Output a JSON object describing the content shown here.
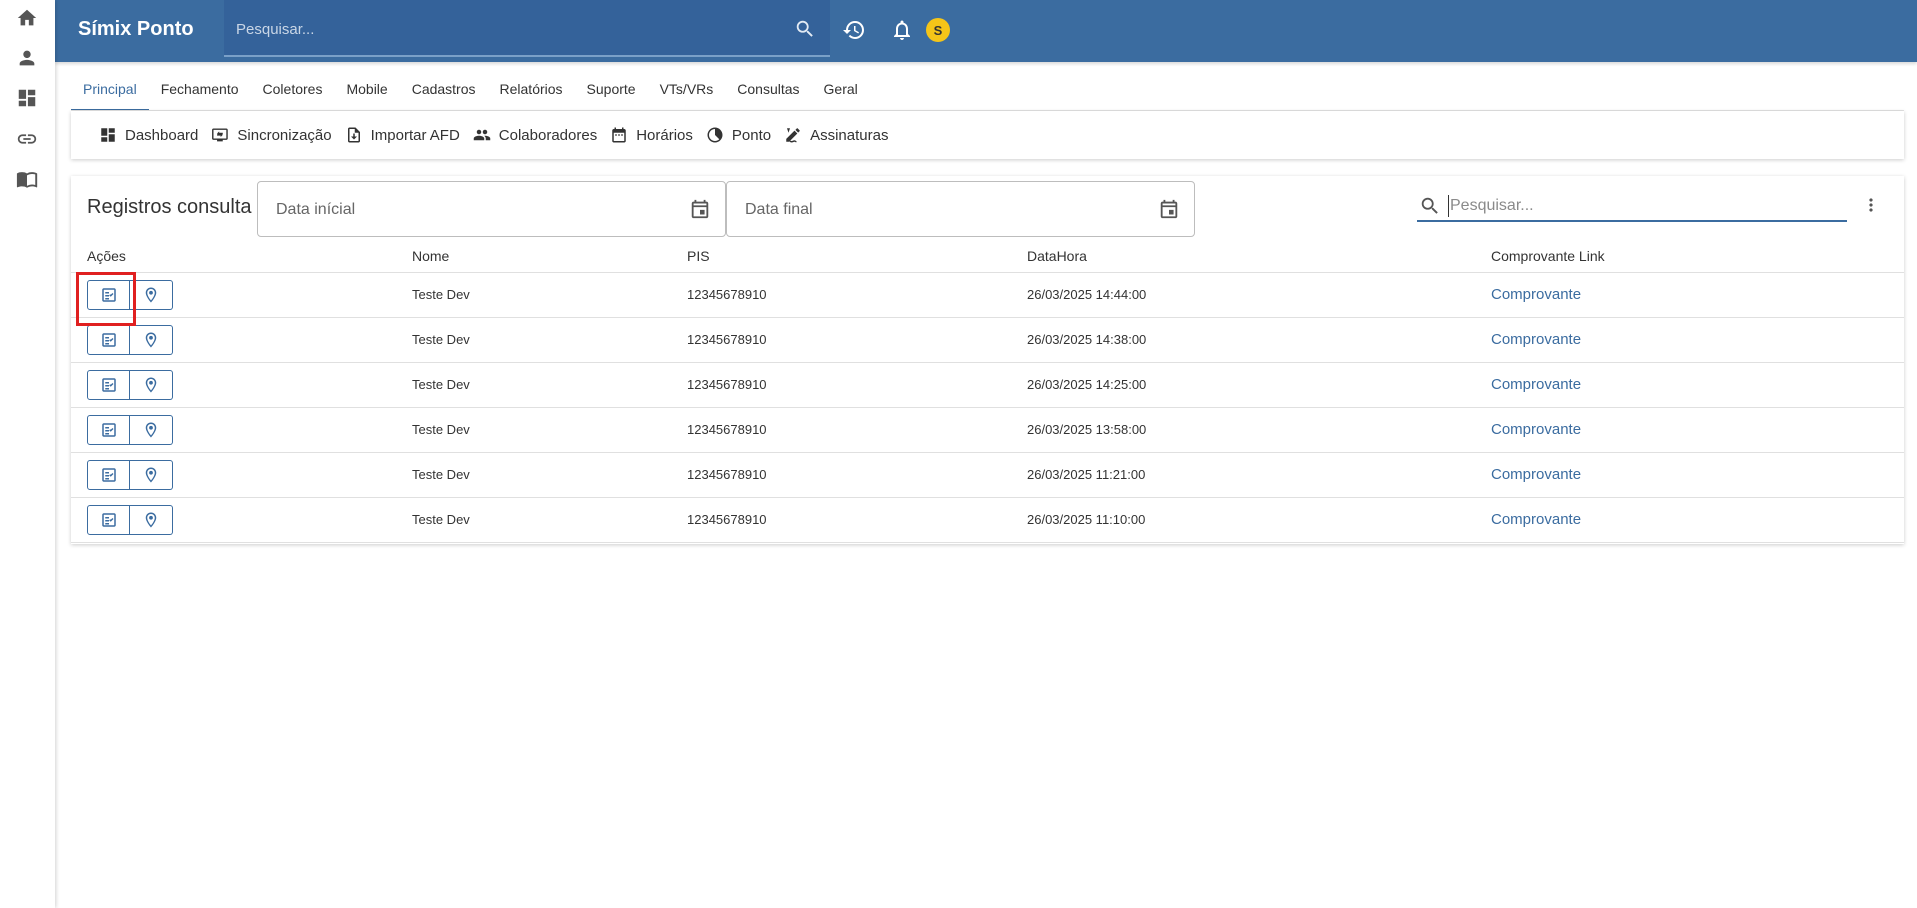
{
  "rail": {
    "items": [
      {
        "icon": "home-icon"
      },
      {
        "icon": "person-icon"
      },
      {
        "icon": "dashboard-icon"
      },
      {
        "icon": "link-icon"
      },
      {
        "icon": "book-icon"
      }
    ]
  },
  "header": {
    "brand": "Símix Ponto",
    "search_placeholder": "Pesquisar...",
    "avatar_initial": "S",
    "colors": {
      "bar": "#3b6ca0",
      "avatar": "#f5c518"
    }
  },
  "tabs": [
    {
      "label": "Principal",
      "active": true
    },
    {
      "label": "Fechamento"
    },
    {
      "label": "Coletores"
    },
    {
      "label": "Mobile"
    },
    {
      "label": "Cadastros"
    },
    {
      "label": "Relatórios"
    },
    {
      "label": "Suporte"
    },
    {
      "label": "VTs/VRs"
    },
    {
      "label": "Consultas"
    },
    {
      "label": "Geral"
    }
  ],
  "toolbar": [
    {
      "label": "Dashboard",
      "icon": "dashboard-icon"
    },
    {
      "label": "Sincronização",
      "icon": "sync-icon"
    },
    {
      "label": "Importar AFD",
      "icon": "import-icon"
    },
    {
      "label": "Colaboradores",
      "icon": "people-icon"
    },
    {
      "label": "Horários",
      "icon": "calendar-icon"
    },
    {
      "label": "Ponto",
      "icon": "clock-icon"
    },
    {
      "label": "Assinaturas",
      "icon": "signature-icon"
    }
  ],
  "card": {
    "title": "Registros consulta",
    "date_start_placeholder": "Data inícial",
    "date_end_placeholder": "Data final",
    "search_placeholder": "Pesquisar...",
    "columns": [
      "Ações",
      "Nome",
      "PIS",
      "DataHora",
      "Comprovante Link"
    ],
    "rows": [
      {
        "nome": "Teste Dev",
        "pis": "12345678910",
        "datahora": "26/03/2025 14:44:00",
        "link": "Comprovante"
      },
      {
        "nome": "Teste Dev",
        "pis": "12345678910",
        "datahora": "26/03/2025 14:38:00",
        "link": "Comprovante"
      },
      {
        "nome": "Teste Dev",
        "pis": "12345678910",
        "datahora": "26/03/2025 14:25:00",
        "link": "Comprovante"
      },
      {
        "nome": "Teste Dev",
        "pis": "12345678910",
        "datahora": "26/03/2025 13:58:00",
        "link": "Comprovante"
      },
      {
        "nome": "Teste Dev",
        "pis": "12345678910",
        "datahora": "26/03/2025 11:21:00",
        "link": "Comprovante"
      },
      {
        "nome": "Teste Dev",
        "pis": "12345678910",
        "datahora": "26/03/2025 11:10:00",
        "link": "Comprovante"
      }
    ]
  }
}
